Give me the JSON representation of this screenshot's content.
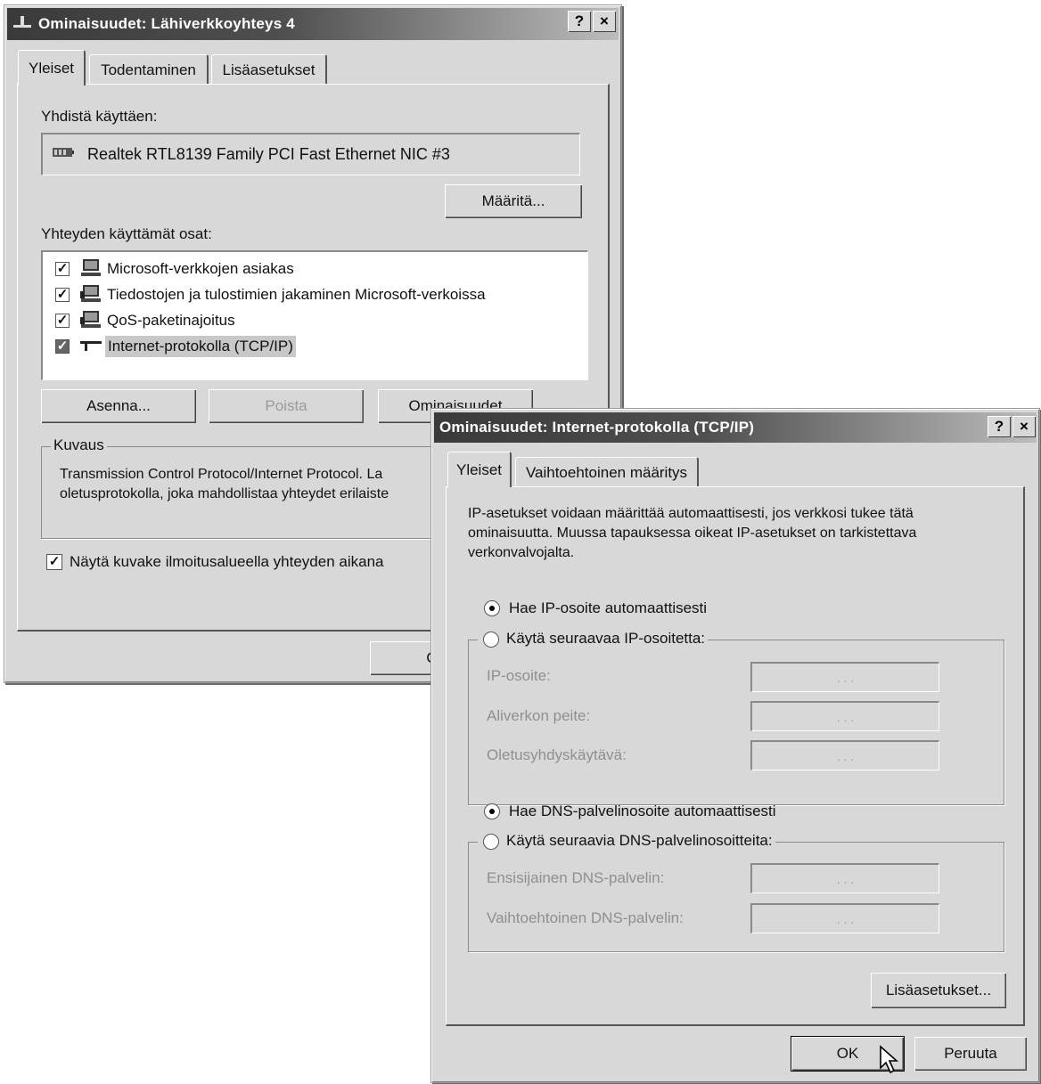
{
  "win1": {
    "title": "Ominaisuudet: Lähiverkkoyhteys 4",
    "help_btn": "?",
    "close_btn": "×",
    "tabs": [
      "Yleiset",
      "Todentaminen",
      "Lisäasetukset"
    ],
    "connect_using_label": "Yhdistä käyttäen:",
    "adapter_name": "Realtek RTL8139 Family PCI Fast Ethernet NIC #3",
    "configure_btn": "Määritä...",
    "components_label": "Yhteyden käyttämät osat:",
    "components": [
      {
        "label": "Microsoft-verkkojen asiakas",
        "checked": true
      },
      {
        "label": "Tiedostojen ja tulostimien jakaminen Microsoft-verkoissa",
        "checked": true
      },
      {
        "label": "QoS-paketinajoitus",
        "checked": true
      },
      {
        "label": "Internet-protokolla (TCP/IP)",
        "checked": true,
        "selected": true
      }
    ],
    "install_btn": "Asenna...",
    "remove_btn": "Poista",
    "properties_btn": "Ominaisuudet",
    "description_legend": "Kuvaus",
    "description_line1": "Transmission Control Protocol/Internet Protocol. La",
    "description_line2": "oletusprotokolla, joka mahdollistaa yhteydet erilaiste",
    "show_icon_label": "Näytä kuvake ilmoitusalueella yhteyden aikana",
    "ok_btn_partial": "O"
  },
  "win2": {
    "title": "Ominaisuudet: Internet-protokolla (TCP/IP)",
    "help_btn": "?",
    "close_btn": "×",
    "tabs": [
      "Yleiset",
      "Vaihtoehtoinen määritys"
    ],
    "intro_line1": "IP-asetukset voidaan määrittää automaattisesti, jos verkkosi tukee tätä",
    "intro_line2": "ominaisuutta. Muussa tapauksessa oikeat IP-asetukset on tarkistettava",
    "intro_line3": "verkonvalvojalta.",
    "radio_ip_auto": "Hae IP-osoite automaattisesti",
    "radio_ip_manual": "Käytä seuraavaa IP-osoitetta:",
    "ip_address_label": "IP-osoite:",
    "subnet_label": "Aliverkon peite:",
    "gateway_label": "Oletusyhdyskäytävä:",
    "radio_dns_auto": "Hae DNS-palvelinosoite automaattisesti",
    "radio_dns_manual": "Käytä seuraavia DNS-palvelinosoitteita:",
    "dns_primary_label": "Ensisijainen DNS-palvelin:",
    "dns_alt_label": "Vaihtoehtoinen DNS-palvelin:",
    "ip_placeholder_dots": ".   .   .",
    "advanced_btn": "Lisäasetukset...",
    "ok_btn": "OK",
    "cancel_btn": "Peruuta"
  }
}
